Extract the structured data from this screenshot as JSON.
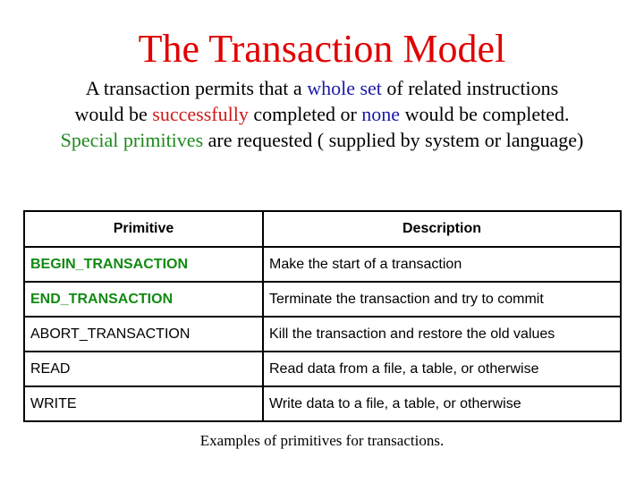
{
  "slide": {
    "title": "The Transaction Model",
    "intro": [
      [
        {
          "text": "A transaction permits that a ",
          "color": "default"
        },
        {
          "text": "whole set",
          "color": "blue"
        },
        {
          "text": " of related instructions",
          "color": "default"
        }
      ],
      [
        {
          "text": "would be ",
          "color": "default"
        },
        {
          "text": "successfully",
          "color": "red"
        },
        {
          "text": " completed or ",
          "color": "default"
        },
        {
          "text": "none",
          "color": "blue"
        },
        {
          "text": " would be completed.",
          "color": "default"
        }
      ],
      [
        {
          "text": "Special primitives",
          "color": "green"
        },
        {
          "text": " are requested ( supplied by system or language)",
          "color": "default"
        }
      ]
    ],
    "table": {
      "headers": [
        "Primitive",
        "Description"
      ],
      "rows": [
        {
          "primitive": "BEGIN_TRANSACTION",
          "description": "Make the start of a transaction",
          "highlight": true
        },
        {
          "primitive": "END_TRANSACTION",
          "description": "Terminate the transaction and try to commit",
          "highlight": true
        },
        {
          "primitive": "ABORT_TRANSACTION",
          "description": "Kill the transaction and restore the old values",
          "highlight": false
        },
        {
          "primitive": "READ",
          "description": "Read data from a file, a table, or otherwise",
          "highlight": false
        },
        {
          "primitive": "WRITE",
          "description": "Write data to a file, a table, or otherwise",
          "highlight": false
        }
      ]
    },
    "caption": "Examples of primitives for transactions.",
    "colors": {
      "title": "#e00000",
      "blue": "#1a1aa6",
      "red": "#d01818",
      "green": "#1e8a1e",
      "highlight_primitive": "#138a13"
    }
  }
}
